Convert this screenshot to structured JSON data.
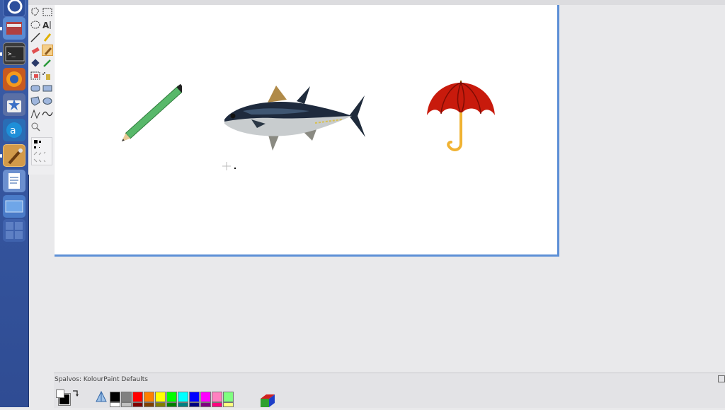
{
  "palette_dock": {
    "title": "Spalvos: KolourPaint Defaults"
  },
  "launcher": {
    "items": [
      "ubuntu-dash-icon",
      "files-icon",
      "terminal-icon",
      "firefox-icon",
      "software-center-icon",
      "libreoffice-icon",
      "kolourpaint-icon",
      "writer-icon",
      "workspace-icon",
      "workspace-switcher-icon"
    ]
  },
  "palette_colors_row1": [
    "#000000",
    "#808080",
    "#ff0000",
    "#ff8000",
    "#ffff00",
    "#00ff00",
    "#00ffff",
    "#0000ff",
    "#ff00ff",
    "#ff80c0",
    "#80ff80"
  ],
  "palette_colors_row2": [
    "#ffffff",
    "#c0c0c0",
    "#800000",
    "#804000",
    "#808000",
    "#008000",
    "#008080",
    "#000080",
    "#800080",
    "#ff0080",
    "#ffff80"
  ]
}
